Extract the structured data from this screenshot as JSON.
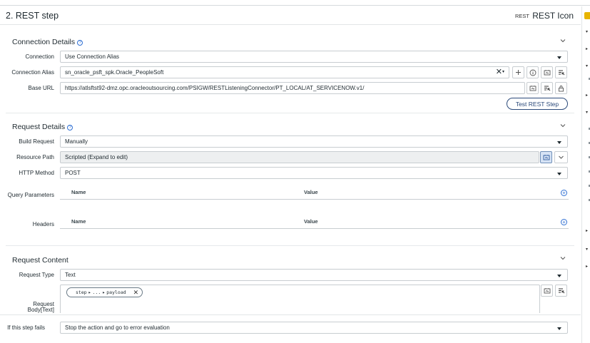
{
  "header": {
    "title": "2.  REST step",
    "badge": "REST",
    "icon_label": "REST Icon"
  },
  "connection": {
    "title": "Connection Details",
    "connection_label": "Connection",
    "connection_value": "Use Connection Alias",
    "alias_label": "Connection Alias",
    "alias_value": "sn_oracle_psft_spk.Oracle_PeopleSoft",
    "base_url_label": "Base URL",
    "base_url_value": "https://atlsftst92-dmz.opc.oracleoutsourcing.com/PSIGW/RESTListeningConnector/PT_LOCAL/AT_SERVICENOW.v1/",
    "test_button": "Test REST Step"
  },
  "request": {
    "title": "Request Details",
    "build_label": "Build Request",
    "build_value": "Manually",
    "resource_label": "Resource Path",
    "resource_value": "Scripted (Expand to edit)",
    "method_label": "HTTP Method",
    "method_value": "POST",
    "query_label": "Query Parameters",
    "headers_label": "Headers",
    "col_name": "Name",
    "col_value": "Value"
  },
  "content": {
    "title": "Request Content",
    "type_label": "Request Type",
    "type_value": "Text",
    "body_label_1": "Request",
    "body_label_2": "Body[Text]",
    "pill_step": "step",
    "pill_dots": "...",
    "pill_payload": "payload"
  },
  "footer": {
    "fail_label": "If this step fails",
    "fail_value": "Stop the action and go to error evaluation"
  },
  "colors": {
    "accent": "#2f6fd3",
    "pill_border": "#2b4a7a",
    "rail_tab": "#e7b400"
  }
}
